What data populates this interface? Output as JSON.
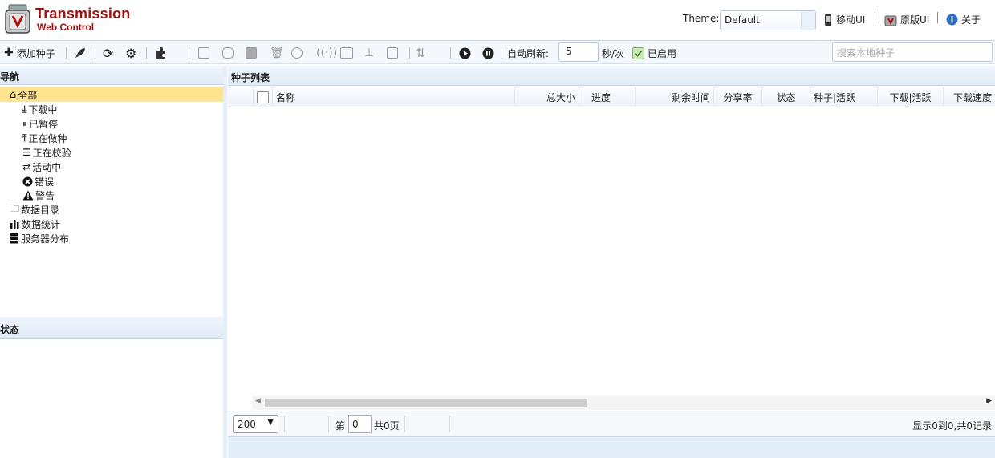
{
  "app": {
    "brand_line1": "Transmission",
    "brand_line2": "Web Control"
  },
  "header": {
    "theme_label": "Theme:",
    "theme_value": "Default",
    "mobile_ui": "移动UI",
    "original_ui": "原版UI",
    "about": "关于"
  },
  "toolbar": {
    "add_torrent": "添加种子",
    "auto_refresh_label": "自动刷新:",
    "refresh_interval": "5",
    "refresh_unit": "秒/次",
    "enabled_label": "已启用",
    "search_placeholder": "搜索本地种子"
  },
  "nav": {
    "title": "导航",
    "items": [
      {
        "label": "全部",
        "icon": "home-icon"
      },
      {
        "label": "下载中",
        "icon": "download-icon"
      },
      {
        "label": "已暂停",
        "icon": "pause-circle-icon"
      },
      {
        "label": "正在做种",
        "icon": "upload-icon"
      },
      {
        "label": "正在校验",
        "icon": "check-database-icon"
      },
      {
        "label": "活动中",
        "icon": "exchange-icon"
      },
      {
        "label": "错误",
        "icon": "error-icon"
      },
      {
        "label": "警告",
        "icon": "warning-icon"
      },
      {
        "label": "数据目录",
        "icon": "folder-icon"
      },
      {
        "label": "数据统计",
        "icon": "bar-chart-icon"
      },
      {
        "label": "服务器分布",
        "icon": "server-icon"
      }
    ]
  },
  "status": {
    "title": "状态"
  },
  "list": {
    "title": "种子列表",
    "columns": [
      "名称",
      "总大小",
      "进度",
      "剩余时间",
      "分享率",
      "状态",
      "种子|活跃",
      "下载|活跃",
      "下载速度"
    ]
  },
  "pager": {
    "page_size": "200",
    "page_prefix": "第",
    "page_value": "0",
    "page_total": "共0页",
    "summary": "显示0到0,共0记录"
  },
  "colors": {
    "brand": "#a01010",
    "selected": "#ffe48d",
    "panel_header": "#e0ebf7"
  }
}
